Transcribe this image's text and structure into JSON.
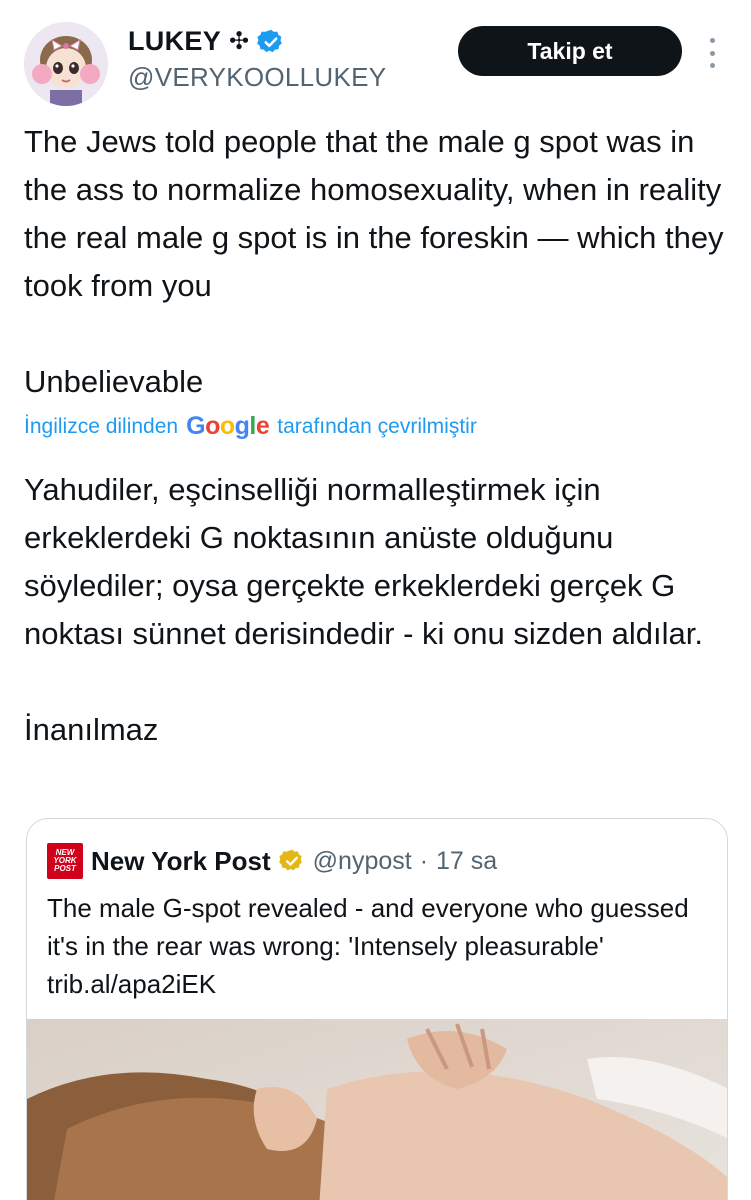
{
  "author": {
    "display_name": "LUKEY",
    "name_glyph": "✣",
    "handle": "@VERYKOOLLUKEY",
    "verified_icon": "blue-verified-badge-icon",
    "avatar_icon": "anime-avatar"
  },
  "follow_label": "Takip et",
  "more_icon": "vertical-ellipsis-icon",
  "tweet_text": "The Jews told people that the male g spot was in the ass to normalize homosexuality, when in reality the real male g spot is in the foreskin — which they took from you\n\nUnbelievable",
  "translation": {
    "prefix": "İngilizce dilinden",
    "logo_text": "Google",
    "suffix": "tarafından çevrilmiştir",
    "text": "Yahudiler, eşcinselliği normalleştirmek için erkeklerdeki G noktasının anüste olduğunu söylediler; oysa gerçekte erkeklerdeki gerçek G noktası sünnet derisindedir - ki onu sizden aldılar.\n\nİnanılmaz"
  },
  "quote": {
    "name": "New York Post",
    "logo_text": "NEW YORK POST",
    "handle": "@nypost",
    "separator": "·",
    "time": "17 sa",
    "text": "The male G-spot revealed - and everyone who guessed it's in the rear was wrong: 'Intensely pleasurable' trib.al/apa2iEK",
    "verified_icon": "gold-verified-badge-icon",
    "image_icon": "photo-woman-massage"
  },
  "colors": {
    "link_blue": "#1d9bf0",
    "text": "#0f1419",
    "secondary": "#536471",
    "border": "#cfd9de",
    "nyp_red": "#d0021b"
  }
}
